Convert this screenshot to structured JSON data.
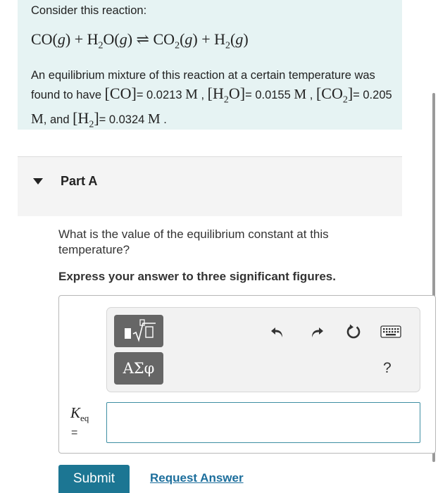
{
  "intro": {
    "lead": "Consider this reaction:",
    "equation_parts": [
      "CO(",
      "g",
      ") + H",
      "2",
      "O(",
      "g",
      ") ⇌ CO",
      "2",
      "(",
      "g",
      ") + H",
      "2",
      "(",
      "g",
      ")"
    ],
    "para": {
      "t1": "An equilibrium mixture of this reaction at a certain temperature was found to have ",
      "co_value": "= 0.0213",
      "h2o_value": "= 0.0155",
      "co2_value": "= 0.205",
      "h2_value": "= 0.0324",
      "unit": "M",
      "and_text": ", and"
    }
  },
  "part": {
    "title": "Part A"
  },
  "question": "What is the value of the equilibrium constant at this temperature?",
  "instruction": "Express your answer to three significant figures.",
  "toolbar": {
    "greek_label": "ΑΣφ",
    "help_label": "?"
  },
  "answer": {
    "label_main": "K",
    "label_sub": "eq",
    "equals": "=",
    "value": ""
  },
  "actions": {
    "submit": "Submit",
    "request": "Request Answer"
  }
}
